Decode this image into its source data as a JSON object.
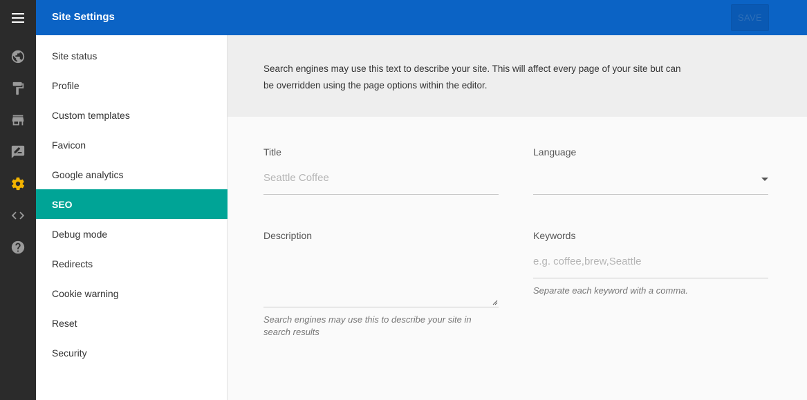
{
  "header": {
    "title": "Site Settings",
    "save_label": "SAVE"
  },
  "rail": {
    "icons": [
      "menu-icon",
      "globe-icon",
      "paint-roller-icon",
      "store-icon",
      "edit-note-icon",
      "gear-icon",
      "code-icon",
      "help-icon"
    ],
    "active_icon": "gear-icon",
    "active_color": "#f2b300"
  },
  "menu": {
    "items": [
      {
        "label": "Site status"
      },
      {
        "label": "Profile"
      },
      {
        "label": "Custom templates"
      },
      {
        "label": "Favicon"
      },
      {
        "label": "Google analytics"
      },
      {
        "label": "SEO"
      },
      {
        "label": "Debug mode"
      },
      {
        "label": "Redirects"
      },
      {
        "label": "Cookie warning"
      },
      {
        "label": "Reset"
      },
      {
        "label": "Security"
      }
    ],
    "active": "SEO",
    "active_color": "#00a496"
  },
  "banner": {
    "text": "Search engines may use this text to describe your site. This will affect every page of your site but can be overridden using the page options within the editor."
  },
  "form": {
    "title": {
      "label": "Title",
      "placeholder": "Seattle Coffee"
    },
    "language": {
      "label": "Language",
      "value": ""
    },
    "description": {
      "label": "Description",
      "value": "",
      "hint": "Search engines may use this to describe your site in search results"
    },
    "keywords": {
      "label": "Keywords",
      "placeholder": "e.g. coffee,brew,Seattle",
      "hint": "Separate each keyword with a comma."
    }
  },
  "colors": {
    "header": "#0b63c5",
    "rail": "#2b2b2b",
    "accent": "#00a496"
  }
}
